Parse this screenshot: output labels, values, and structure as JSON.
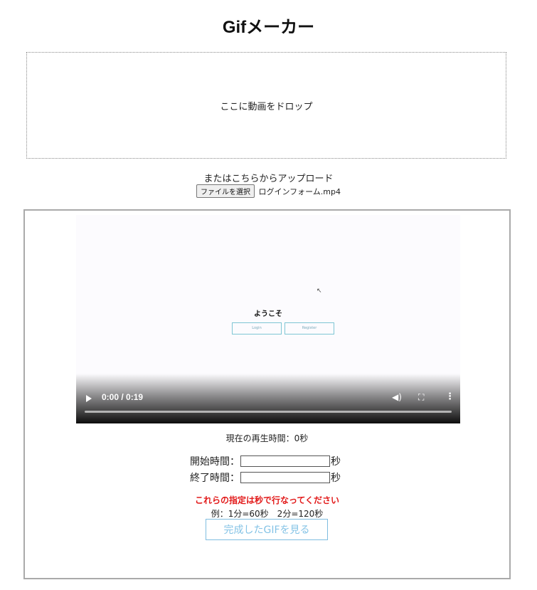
{
  "header": {
    "title": "Gifメーカー"
  },
  "dropzone": {
    "text": "ここに動画をドロップ"
  },
  "upload": {
    "label": "またはこちらからアップロード",
    "button_label": "ファイルを選択",
    "file_name": "ログインフォーム.mp4"
  },
  "video": {
    "preview_heading": "ようこそ",
    "preview_login": "Login",
    "preview_register": "Register",
    "time_display": "0:00 / 0:19",
    "icons": {
      "play": "play-icon",
      "volume": "volume-icon",
      "fullscreen": "fullscreen-icon",
      "more": "more-icon"
    }
  },
  "playback": {
    "current_time_text": "現在の再生時間：0秒"
  },
  "range": {
    "start_label": "開始時間：",
    "end_label": "終了時間：",
    "unit": "秒",
    "start_value": "",
    "end_value": ""
  },
  "notes": {
    "warning": "これらの指定は秒で行なってください",
    "example": "例：1分=60秒　2分=120秒"
  },
  "actions": {
    "view_gif_label": "完成したGIFを見る"
  },
  "colors": {
    "warning": "#e21a1a",
    "button_text": "#84c3e6",
    "button_border": "#7fbde0"
  }
}
